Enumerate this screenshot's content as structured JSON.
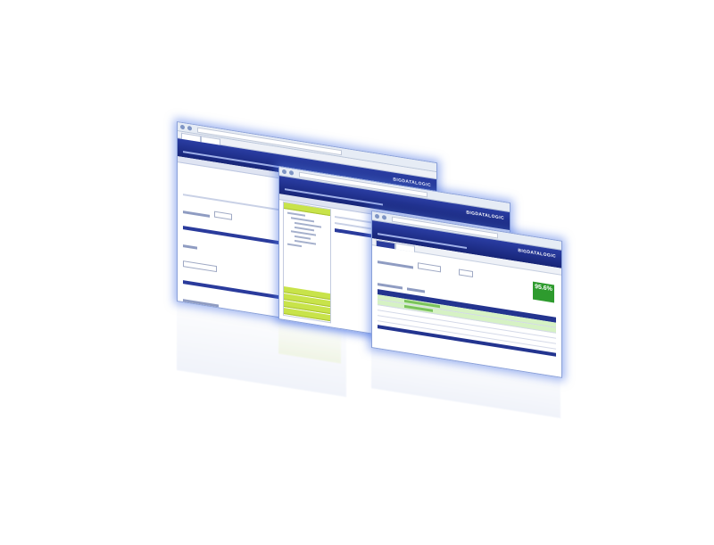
{
  "colors": {
    "header_blue": "#1e2f8f",
    "accent_lime": "#c8e34a",
    "kpi_green": "#2e9b2e",
    "row_green": "#d6f2c4",
    "glow_blue": "#5078e6"
  },
  "windows": [
    {
      "id": "back",
      "logo": "BIGDATALOGIC"
    },
    {
      "id": "mid",
      "logo": "BIGDATALOGIC"
    },
    {
      "id": "front",
      "logo": "BIGDATALOGIC",
      "kpi_value": "95.6%"
    }
  ],
  "icons": {
    "browser_back": "circle-arrow-left",
    "browser_forward": "circle-arrow-right"
  }
}
